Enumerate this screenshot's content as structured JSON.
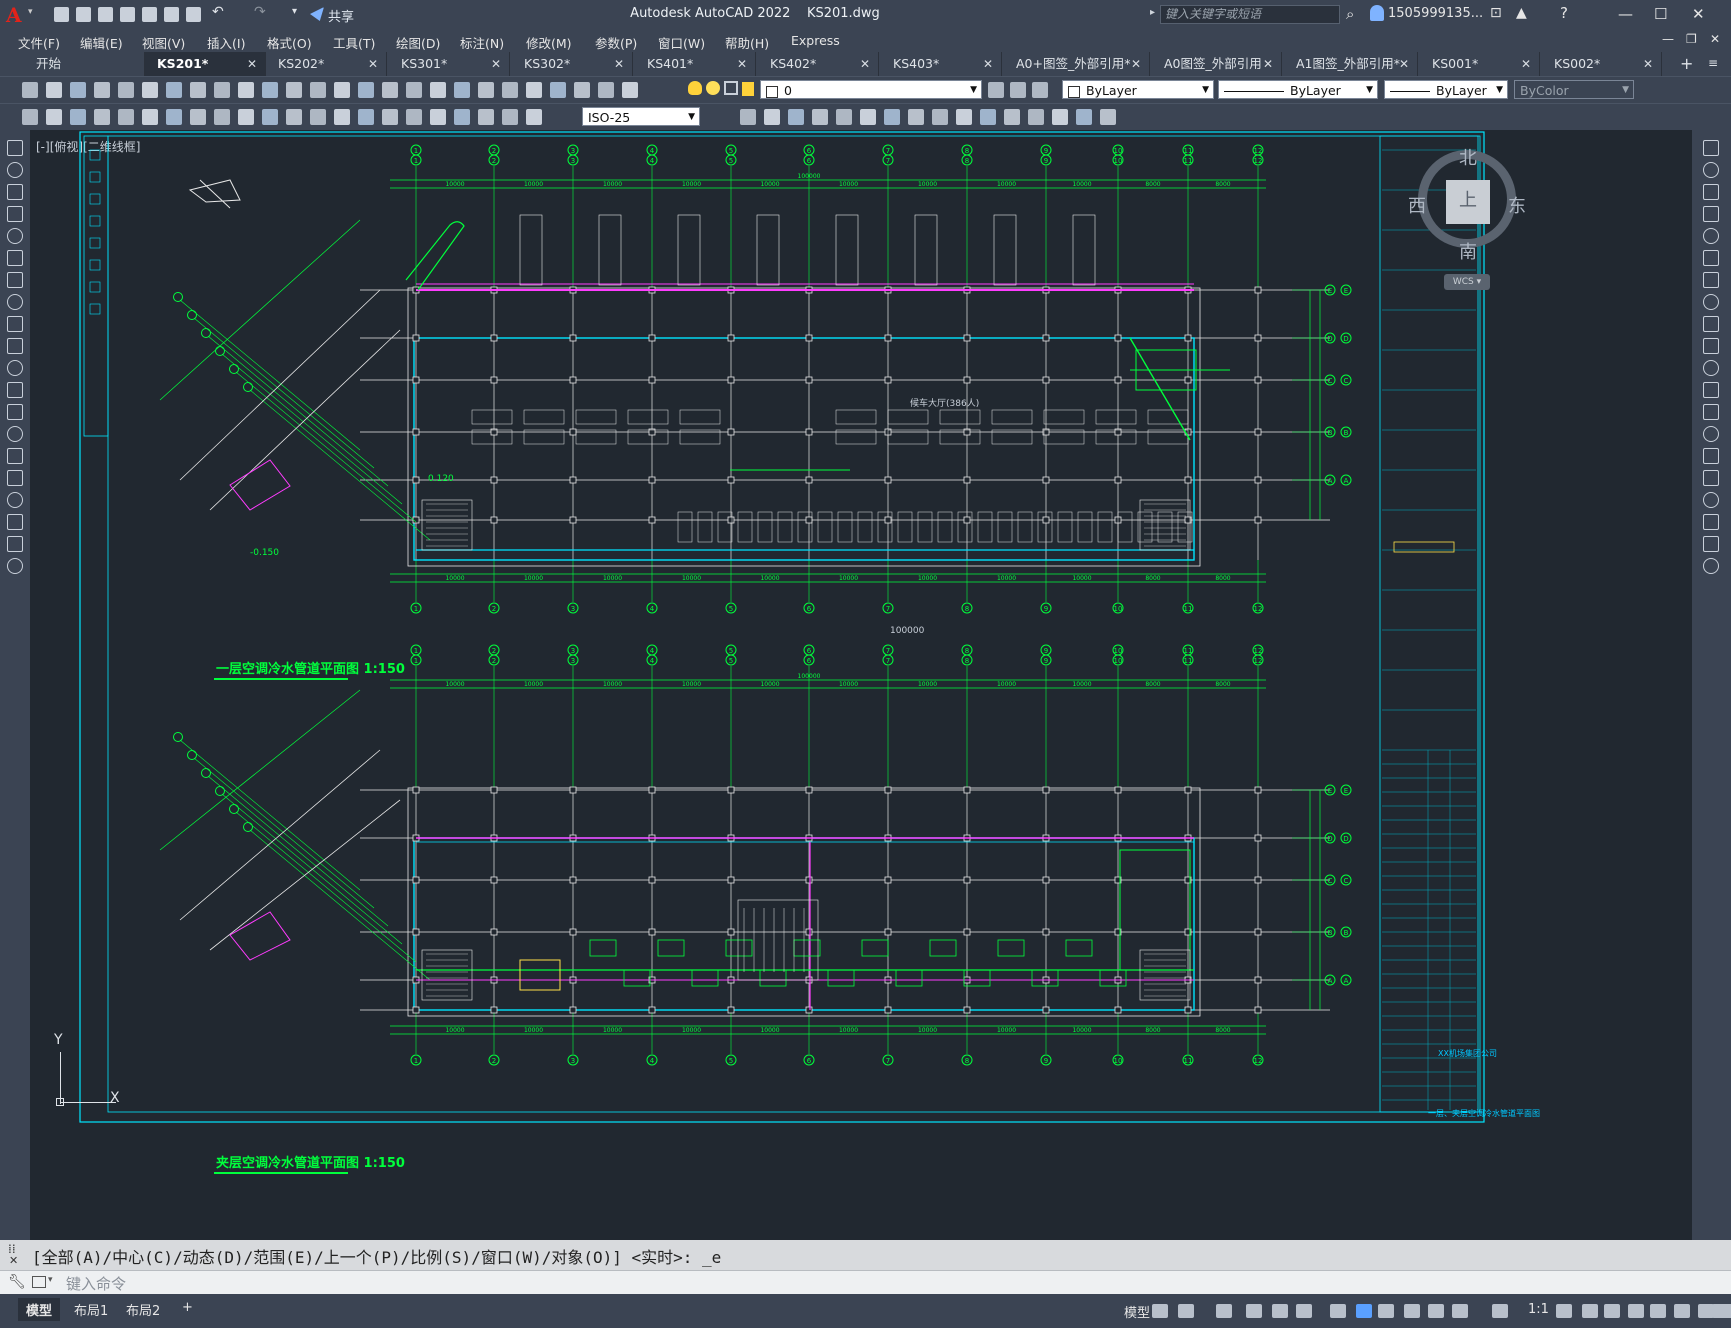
{
  "titlebar": {
    "app_name": "Autodesk AutoCAD 2022",
    "file_name": "KS201.dwg",
    "share_label": "共享",
    "search_placeholder": "键入关键字或短语",
    "user_name": "1505999135...",
    "app_logo": "A"
  },
  "menu": [
    "文件(F)",
    "编辑(E)",
    "视图(V)",
    "插入(I)",
    "格式(O)",
    "工具(T)",
    "绘图(D)",
    "标注(N)",
    "修改(M)",
    "参数(P)",
    "窗口(W)",
    "帮助(H)",
    "Express"
  ],
  "tabs": [
    {
      "label": "开始",
      "active": false,
      "closable": false
    },
    {
      "label": "KS201*",
      "active": true,
      "closable": true
    },
    {
      "label": "KS202*",
      "active": false,
      "closable": true
    },
    {
      "label": "KS301*",
      "active": false,
      "closable": true
    },
    {
      "label": "KS302*",
      "active": false,
      "closable": true
    },
    {
      "label": "KS401*",
      "active": false,
      "closable": true
    },
    {
      "label": "KS402*",
      "active": false,
      "closable": true
    },
    {
      "label": "KS403*",
      "active": false,
      "closable": true
    },
    {
      "label": "A0+图签_外部引用*",
      "active": false,
      "closable": true
    },
    {
      "label": "A0图签_外部引用",
      "active": false,
      "closable": true
    },
    {
      "label": "A1图签_外部引用*",
      "active": false,
      "closable": true
    },
    {
      "label": "KS001*",
      "active": false,
      "closable": true
    },
    {
      "label": "KS002*",
      "active": false,
      "closable": true
    }
  ],
  "tab_add": "+",
  "properties": {
    "layer_value": "0",
    "color": "ByLayer",
    "linetype": "ByLayer",
    "lineweight": "ByLayer",
    "plotstyle": "ByColor",
    "dimstyle": "ISO-25"
  },
  "viewport_label": "[-][俯视][二维线框]",
  "viewcube": {
    "north": "北",
    "south": "南",
    "east": "东",
    "west": "西",
    "top": "上",
    "wcs": "WCS"
  },
  "drawing": {
    "title_first_floor": "一层空调冷水管道平面图  1:150",
    "title_mezzanine": "夹层空调冷水管道平面图  1:150",
    "grid_numbers": [
      "1",
      "2",
      "3",
      "4",
      "5",
      "6",
      "7",
      "8",
      "9",
      "10",
      "11",
      "12"
    ],
    "grid_letters_upper": [
      "E",
      "D",
      "C",
      "B",
      "A"
    ],
    "grid_letters_lower": [
      "E",
      "D",
      "C",
      "B",
      "A"
    ],
    "dim_segments": [
      "10000",
      "10000",
      "10000",
      "10000",
      "10000",
      "10000",
      "10000",
      "10000",
      "10000",
      "8000",
      "8000"
    ],
    "total_dim": "100000",
    "elevation_1": "-0.150",
    "elevation_2": "0.120",
    "room_label": "候车大厅(386人)",
    "title_block_company": "XX机场集团公司",
    "title_block_drawing": "一层、夹层空调冷水管道平面图"
  },
  "command": {
    "history": "[全部(A)/中心(C)/动态(D)/范围(E)/上一个(P)/比例(S)/窗口(W)/对象(O)] <实时>: _e",
    "placeholder": "键入命令"
  },
  "status": {
    "layouts": [
      "模型",
      "布局1",
      "布局2"
    ],
    "add_layout": "+",
    "model_label": "模型",
    "scale": "1:1"
  },
  "colors": {
    "background": "#212830",
    "chrome": "#3b4453",
    "cad_green": "#00ff3c",
    "cad_white": "#e8e8e8",
    "cad_cyan": "#00e5ff",
    "cad_magenta": "#ff3cff",
    "title_block": "#00b4c8"
  }
}
